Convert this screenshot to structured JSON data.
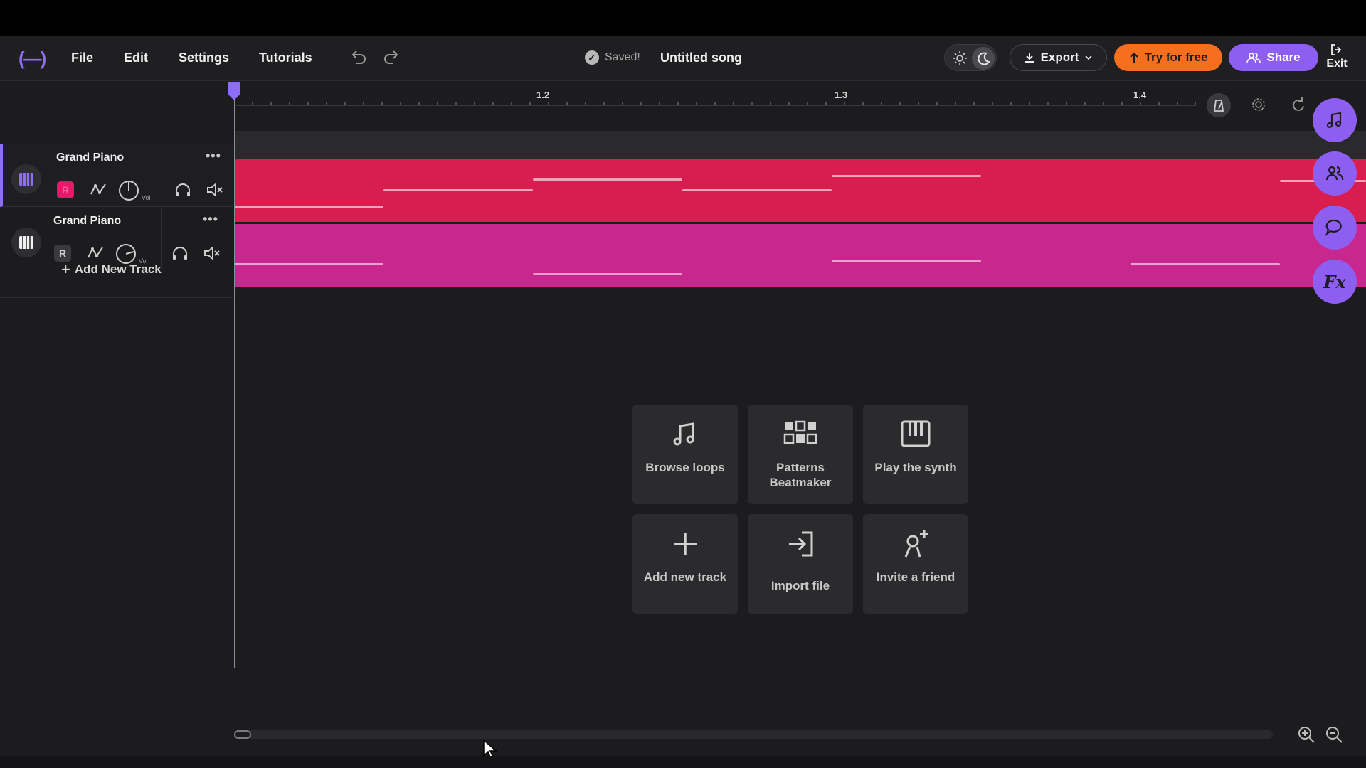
{
  "header": {
    "menu": [
      "File",
      "Edit",
      "Settings",
      "Tutorials"
    ],
    "saved_status": "Saved!",
    "song_title": "Untitled song",
    "export_label": "Export",
    "try_label": "Try for free",
    "share_label": "Share",
    "exit_label": "Exit"
  },
  "ruler": {
    "labels": [
      "1.2",
      "1.3",
      "1.4"
    ]
  },
  "tracks": [
    {
      "name": "Grand Piano",
      "more": "•••",
      "rec_label": "R",
      "vol_label": "Vol",
      "selected": true,
      "color": "#d91d4f"
    },
    {
      "name": "Grand Piano",
      "more": "•••",
      "rec_label": "R",
      "vol_label": "Vol",
      "selected": false,
      "color": "#c8278e"
    }
  ],
  "add_track_label": "Add New Track",
  "quick_actions": [
    {
      "label": "Browse loops",
      "icon": "music-note-icon"
    },
    {
      "label": "Patterns Beatmaker",
      "icon": "grid-pads-icon"
    },
    {
      "label": "Play the synth",
      "icon": "piano-keys-icon"
    },
    {
      "label": "Add new track",
      "icon": "plus-icon"
    },
    {
      "label": "Import file",
      "icon": "import-icon"
    },
    {
      "label": "Invite a friend",
      "icon": "user-plus-icon"
    }
  ],
  "right_rail": [
    {
      "icon": "music-note-icon"
    },
    {
      "icon": "people-icon"
    },
    {
      "icon": "chat-bubble-icon"
    },
    {
      "icon": "fx-icon",
      "text": "Fx"
    }
  ],
  "colors": {
    "accent": "#8e5ef0",
    "try_button": "#f56f1e",
    "track1": "#d91d4f",
    "track2": "#c8278e"
  }
}
